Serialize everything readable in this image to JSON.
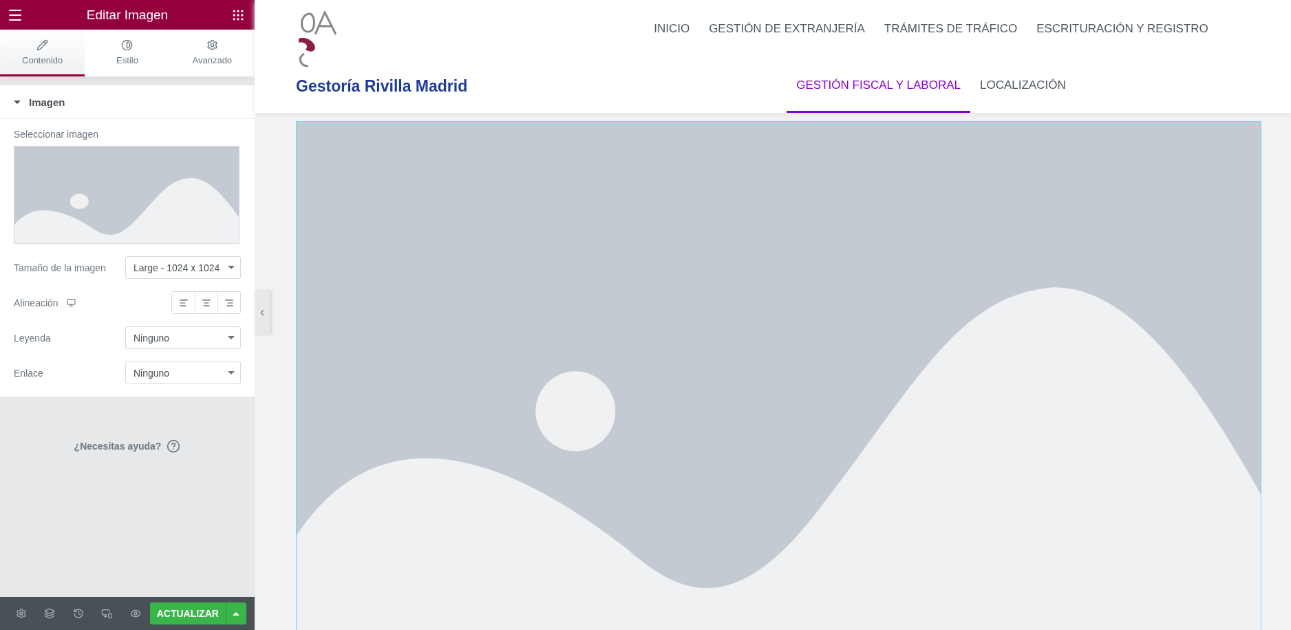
{
  "editor": {
    "title": "Editar Imagen",
    "tabs": [
      {
        "label": "Contenido",
        "selected": true
      },
      {
        "label": "Estilo",
        "selected": false
      },
      {
        "label": "Avanzado",
        "selected": false
      }
    ],
    "section": {
      "title": "Imagen",
      "expanded": true
    },
    "controls": [
      {
        "kind": "media",
        "label": "Seleccionar imagen"
      },
      {
        "kind": "select",
        "label": "Tamaño de la imagen",
        "value": "Large - 1024 x 1024"
      },
      {
        "kind": "align",
        "label": "Alineación"
      },
      {
        "kind": "select",
        "label": "Leyenda",
        "value": "Ninguno"
      },
      {
        "kind": "select",
        "label": "Enlace",
        "value": "Ninguno"
      }
    ],
    "help": "¿Necesitas ayuda?",
    "update_button": "ACTUALIZAR"
  },
  "site": {
    "brand": "Gestoría Rivilla Madrid",
    "nav": [
      {
        "label": "INICIO",
        "selected": false
      },
      {
        "label": "GESTIÓN DE EXTRANJERÍA",
        "selected": false
      },
      {
        "label": "TRÁMITES DE TRÁFICO",
        "selected": false
      },
      {
        "label": "ESCRITURACIÓN Y REGISTRO",
        "selected": false
      },
      {
        "label": "GESTIÓN FISCAL Y LABORAL",
        "selected": true
      },
      {
        "label": "LOCALIZACIÓN",
        "selected": false
      }
    ]
  }
}
